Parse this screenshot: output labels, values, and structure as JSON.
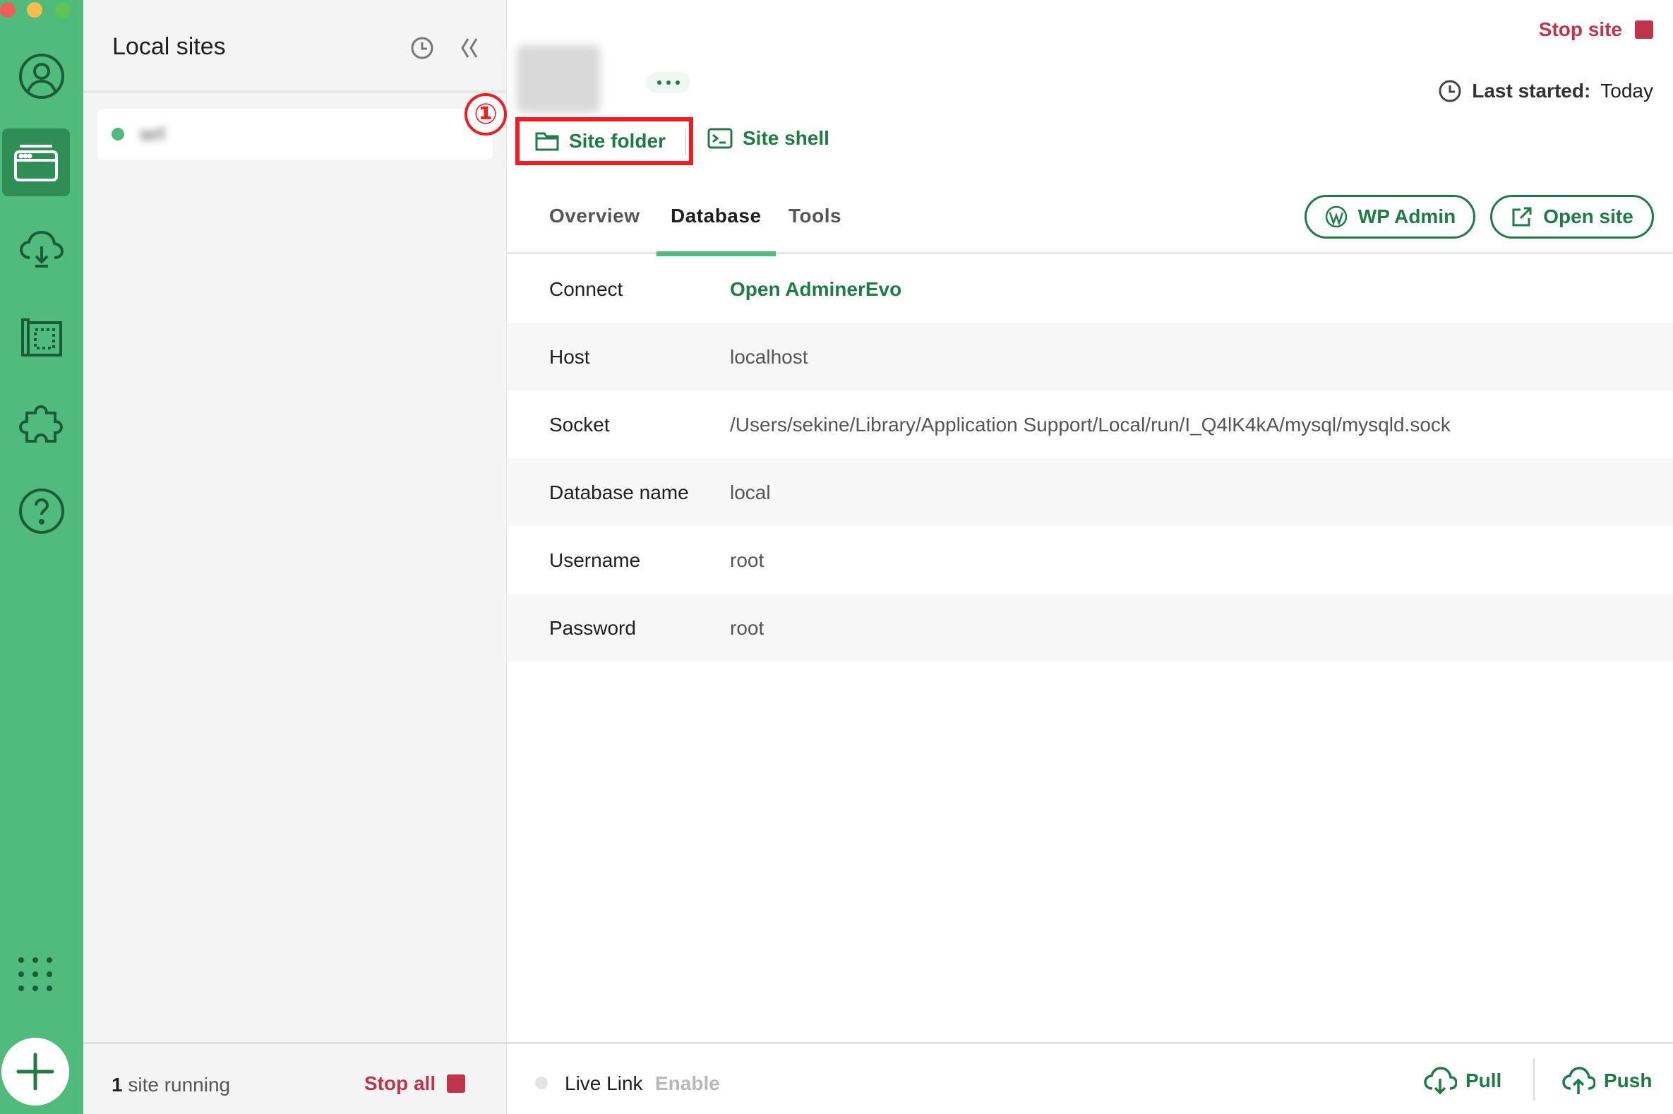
{
  "colors": {
    "rail": "#51bb7b",
    "rail_active": "#2f8d56",
    "brand_dark": "#1f7a46",
    "stop_red": "#c0344b",
    "annotation_red": "#ee1c24"
  },
  "rail": {
    "items": [
      {
        "name": "account",
        "icon": "user-circle-icon"
      },
      {
        "name": "local-sites",
        "icon": "browser-window-icon",
        "active": true
      },
      {
        "name": "cloud-backups",
        "icon": "cloud-icon"
      },
      {
        "name": "blueprints",
        "icon": "blueprint-icon"
      },
      {
        "name": "add-ons",
        "icon": "puzzle-icon"
      },
      {
        "name": "help",
        "icon": "question-circle-icon"
      }
    ],
    "grid_icon": "grid-dots-icon",
    "add_icon": "plus-icon"
  },
  "sites_panel": {
    "title": "Local sites",
    "history_icon": "clock-icon",
    "collapse_icon": "double-chevron-left-icon",
    "site": {
      "name": "wrl",
      "status": "running"
    },
    "footer": {
      "running_count": "1",
      "running_text": " site running",
      "stop_all": "Stop all"
    }
  },
  "site": {
    "stop_site": "Stop site",
    "more_icon": "ellipsis-icon",
    "last_started_label": "Last started:",
    "last_started_value": "Today",
    "annotation_marker": "①",
    "site_folder": "Site folder",
    "site_shell": "Site shell",
    "tabs": [
      "Overview",
      "Database",
      "Tools"
    ],
    "active_tab": "Database",
    "wp_admin": "WP Admin",
    "open_site": "Open site"
  },
  "database": {
    "rows": [
      {
        "key": "Connect",
        "value": "Open AdminerEvo",
        "link": true
      },
      {
        "key": "Host",
        "value": "localhost"
      },
      {
        "key": "Socket",
        "value": "/Users/sekine/Library/Application Support/Local/run/I_Q4lK4kA/mysql/mysqld.sock"
      },
      {
        "key": "Database name",
        "value": "local"
      },
      {
        "key": "Username",
        "value": "root"
      },
      {
        "key": "Password",
        "value": "root"
      }
    ]
  },
  "footer": {
    "live_link_label": "Live Link",
    "live_link_action": "Enable",
    "pull": "Pull",
    "push": "Push"
  }
}
